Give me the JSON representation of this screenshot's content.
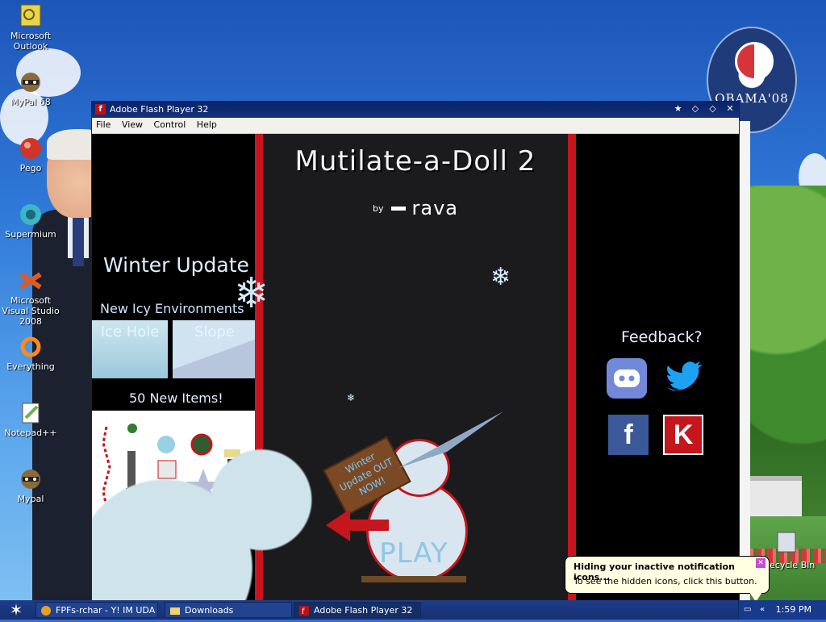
{
  "desktop": {
    "icons": [
      {
        "name": "microsoft-outlook",
        "label": "Microsoft Outlook",
        "color": "#d8c23a"
      },
      {
        "name": "mypal-68",
        "label": "MyPal 68",
        "color": "#8a6a3a"
      },
      {
        "name": "pego",
        "label": "Pego",
        "color": "#d0342a"
      },
      {
        "name": "supermium",
        "label": "Supermium",
        "color": "#3bb5c8"
      },
      {
        "name": "microsoft-visual-studio-2008",
        "label": "Microsoft Visual Studio 2008",
        "color": "#e05a20"
      },
      {
        "name": "everything",
        "label": "Everything",
        "color": "#ff8a1a"
      },
      {
        "name": "notepad-plus-plus",
        "label": "Notepad++",
        "color": "#6fb24a"
      },
      {
        "name": "mypal",
        "label": "Mypal",
        "color": "#8a6a3a"
      }
    ],
    "obama_badge": {
      "text": "OBAMA'08"
    },
    "recycle_bin_label": "ecycle Bin"
  },
  "flash_window": {
    "title": "Adobe Flash Player 32",
    "menu": [
      "File",
      "View",
      "Control",
      "Help"
    ]
  },
  "game": {
    "title": "Mutilate-a-Doll 2",
    "byline_by": "by",
    "byline_author": "rava",
    "left_panel": {
      "winter_update": "Winter Update",
      "new_environments": "New Icy Environments",
      "environments": [
        "Ice Hole",
        "Slope"
      ],
      "new_items": "50 New Items!"
    },
    "sign_text": "Winter Update OUT NOW!",
    "play_label": "PLAY",
    "right_panel": {
      "feedback": "Feedback?",
      "social": [
        {
          "name": "discord",
          "color": "#7289da",
          "glyph": "◉"
        },
        {
          "name": "twitter",
          "color": "#1da1f2",
          "glyph": "🐦"
        },
        {
          "name": "facebook",
          "color": "#3b5998",
          "glyph": "f"
        },
        {
          "name": "kongregate",
          "color": "#c4161c",
          "glyph": "K"
        }
      ]
    },
    "colors": {
      "accent_red": "#c4161c",
      "stage_bg": "#1b1b1e"
    }
  },
  "taskbar": {
    "tasks": [
      {
        "label": "FPFs-rchar - Y! IM UDA"
      },
      {
        "label": "Downloads"
      },
      {
        "label": "Adobe Flash Player 32",
        "active": true
      }
    ],
    "clock": "1:59 PM"
  },
  "balloon": {
    "title": "Hiding your inactive notification icons...",
    "text": "To see the hidden icons, click this button."
  }
}
